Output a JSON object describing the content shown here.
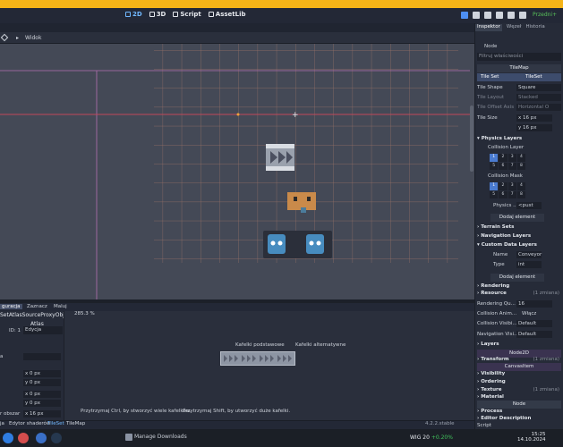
{
  "topbar": {
    "nav": [
      {
        "label": "2D",
        "active": true
      },
      {
        "label": "3D",
        "active": false
      },
      {
        "label": "Script",
        "active": false
      },
      {
        "label": "AssetLib",
        "active": false
      }
    ],
    "renderer": "Przedni+"
  },
  "viewport_toolbar": {
    "view_label": "Widok"
  },
  "bottom_tabs": [
    {
      "label": "guracja",
      "active": true
    },
    {
      "label": "Zaznacz",
      "active": false
    },
    {
      "label": "Maluj",
      "active": false
    }
  ],
  "left_panel": {
    "title": "SetAtlasSourceProxyObject",
    "atlas": "Atlas",
    "id_label": "ID: 1",
    "id_button": "Edycja",
    "rows": [
      {
        "label": "x",
        "value": "0",
        "unit": "px"
      },
      {
        "label": "y",
        "value": "0",
        "unit": "px"
      },
      {
        "label": "x",
        "value": "0",
        "unit": "px"
      },
      {
        "label": "y",
        "value": "0",
        "unit": "px"
      },
      {
        "label": "x",
        "value": "16",
        "unit": "px"
      }
    ],
    "side_labels": [
      "a",
      "",
      "",
      "",
      "r obszar"
    ]
  },
  "atlas_panel": {
    "zoom": "285.3 %",
    "tiles_basic": "Kafelki podstawowe",
    "tiles_alt": "Kafelki alternatywne",
    "hint_ctrl": "Przytrzymaj Ctrl, by stworzyć wiele kafelków.",
    "hint_shift": "Przytrzymaj Shift, by utworzyć duże kafelki."
  },
  "statusbar": {
    "items": [
      {
        "label": "Edytor shaderów",
        "active": false
      },
      {
        "label": "TileSet",
        "active": true
      },
      {
        "label": "TileMap",
        "active": false
      }
    ],
    "left_partial": "ja",
    "version": "4.2.2.stable"
  },
  "inspector": {
    "tabs": [
      {
        "label": "Inspektor",
        "active": true
      },
      {
        "label": "Węzeł",
        "active": false
      },
      {
        "label": "Historia",
        "active": false
      }
    ],
    "node": "Node",
    "filter_placeholder": "Filtruj właściwości",
    "header": "TileMap",
    "tile_set_label": "Tile Set",
    "tile_set_value": "TileSet",
    "tile_shape": {
      "label": "Tile Shape",
      "value": "Square"
    },
    "tile_layout": {
      "label": "Tile Layout",
      "value": "Stacked"
    },
    "tile_offset_axis": {
      "label": "Tile Offset Axis",
      "value": "Horizontal O"
    },
    "tile_size": {
      "label": "Tile Size",
      "x": "16",
      "y": "16",
      "unit": "px"
    },
    "physics_layers": "Physics Layers",
    "collision_layer": "Collision Layer",
    "collision_mask": "Collision Mask",
    "layer_grid": [
      "1",
      "2",
      "3",
      "4",
      "5",
      "6",
      "7",
      "8"
    ],
    "physics_material": {
      "label": "Physics ...",
      "value": "<pust"
    },
    "add_element": "Dodaj element",
    "terrain_sets": "Terrain Sets",
    "navigation_layers": "Navigation Layers",
    "custom_data_layers": "Custom Data Layers",
    "custom_name": {
      "label": "Name",
      "value": "Conveyor"
    },
    "custom_type": {
      "label": "Type",
      "value": "int"
    },
    "rendering": "Rendering",
    "resource": "Resource",
    "resource_changes": "(1 zmiana)",
    "rendering_quadrant": {
      "label": "Rendering Qu...",
      "value": "16"
    },
    "collision_anim": {
      "label": "Collision Anim...",
      "value": "Włącz"
    },
    "collision_visible": {
      "label": "Collision Visibi...",
      "value": "Default"
    },
    "navigation_visible": {
      "label": "Navigation Visi...",
      "value": "Default"
    },
    "layers": "Layers",
    "node2d": "Node2D",
    "transform": "Transform",
    "transform_changes": "(1 zmiana)",
    "canvasitem": "CanvasItem",
    "visibility": "Visibility",
    "ordering": "Ordering",
    "texture": "Texture",
    "texture_changes": "(1 zmiana)",
    "material": "Material",
    "process": "Process",
    "editor_description": "Editor Description",
    "script": "Script"
  },
  "taskbar": {
    "download": "Manage Downloads",
    "index_name": "WIG 20",
    "index_change": "+0.20%",
    "time": "15:25",
    "date": "14.10.2024"
  }
}
